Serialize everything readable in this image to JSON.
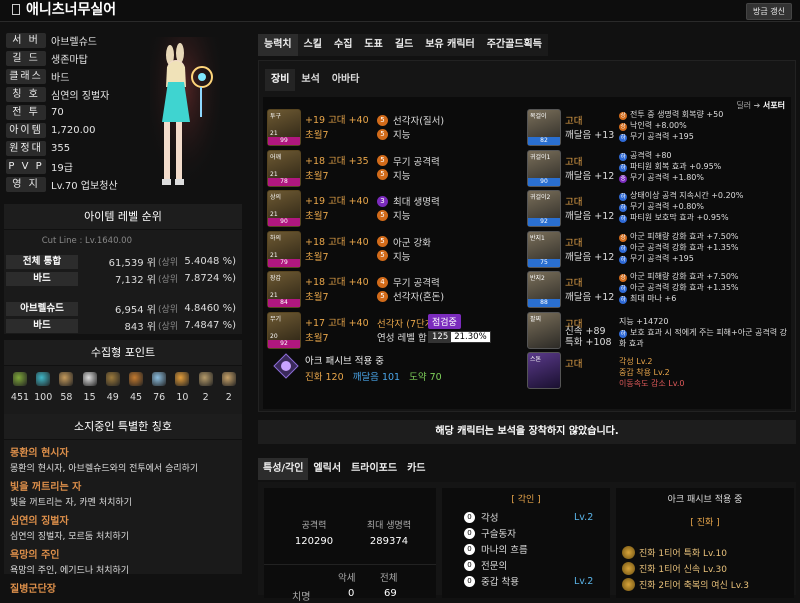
{
  "header": {
    "name": "애니츠너무실어",
    "update_label": "방금 갱신"
  },
  "profile": [
    {
      "k": "서 버",
      "v": "아브렐슈드"
    },
    {
      "k": "길 드",
      "v": "생존마탑"
    },
    {
      "k": "클래스",
      "v": "바드"
    },
    {
      "k": "칭 호",
      "v": "심연의 징벌자"
    },
    {
      "k": "전 투",
      "v": "70"
    },
    {
      "k": "아이템",
      "v": "1,720.00"
    },
    {
      "k": "원정대",
      "v": "355"
    },
    {
      "k": "P V P",
      "v": "19급"
    },
    {
      "k": "영 지",
      "v": "Lv.70 업보청산"
    }
  ],
  "rank": {
    "title": "아이템 레벨 순위",
    "cutline": "Cut Line : Lv.1640.00",
    "rows": [
      {
        "label": "전체 통합",
        "rank": "61,539 위",
        "sub": "(상위",
        "pct": "5.4048 %)"
      },
      {
        "label": "바드",
        "rank": "7,132 위",
        "sub": "(상위",
        "pct": "7.8724 %)"
      },
      {
        "label": "아브렐슈드",
        "rank": "6,954 위",
        "sub": "(상위",
        "pct": "4.8460 %)"
      },
      {
        "label": "바드",
        "rank": "843 위",
        "sub": "(상위",
        "pct": "7.4847 %)"
      }
    ]
  },
  "collect": {
    "title": "수집형 포인트",
    "items": [
      {
        "icon": "island-heart-icon",
        "n": "451",
        "color": "#7fa83a"
      },
      {
        "icon": "orpheus-star-icon",
        "n": "100",
        "color": "#3fb7c7"
      },
      {
        "icon": "giant-heart-icon",
        "n": "58",
        "color": "#c49a5c"
      },
      {
        "icon": "mokoko-seed-icon",
        "n": "15",
        "color": "#ddd"
      },
      {
        "icon": "masterpiece-icon",
        "n": "49",
        "color": "#9c7a3c"
      },
      {
        "icon": "voyage-adventure-icon",
        "n": "45",
        "color": "#c37a2f"
      },
      {
        "icon": "world-tree-leaf-icon",
        "n": "76",
        "color": "#8dbfe0"
      },
      {
        "icon": "ignea-token-icon",
        "n": "10",
        "color": "#e39d3a"
      },
      {
        "icon": "sea-bounty-icon",
        "n": "2",
        "color": "#b59b6a"
      },
      {
        "icon": "recipe-icon",
        "n": "2",
        "color": "#c8a36a"
      }
    ]
  },
  "titles": {
    "title": "소지중인 특별한 칭호",
    "items": [
      {
        "h": "몽환의 현시자",
        "d": "몽환의 현시자, 아브렐슈드와의 전투에서 승리하기"
      },
      {
        "h": "빛을 꺼트리는 자",
        "d": "빛을 꺼트리는 자, 카멘 처치하기"
      },
      {
        "h": "심연의 징벌자",
        "d": "심연의 징벌자, 모르둠 처치하기"
      },
      {
        "h": "욕망의 주인",
        "d": "욕망의 주인, 에기드나 처치하기"
      },
      {
        "h": "질병군단장",
        "d": ""
      }
    ]
  },
  "tabs": [
    "능력치",
    "스킬",
    "수집",
    "도표",
    "길드",
    "보유 캐릭터",
    "주간골드획득"
  ],
  "subtabs": [
    "장비",
    "보석",
    "아바타"
  ],
  "dealer": {
    "a": "딜러",
    "b": "서포터"
  },
  "equip": [
    {
      "slot": "투구",
      "lv": "21",
      "q": "99",
      "title": "+19 고대 +40",
      "elixir": "초월7",
      "e1": {
        "n": "5",
        "t": "선각자(질서)"
      },
      "e2": {
        "n": "5",
        "t": "지능"
      }
    },
    {
      "slot": "어깨",
      "lv": "21",
      "q": "78",
      "title": "+18 고대 +35",
      "elixir": "초월7",
      "e1": {
        "n": "5",
        "t": "무기 공격력"
      },
      "e2": {
        "n": "5",
        "t": "지능"
      }
    },
    {
      "slot": "상의",
      "lv": "21",
      "q": "90",
      "title": "+19 고대 +40",
      "elixir": "초월7",
      "e1": {
        "n": "3",
        "t": "최대 생명력",
        "p": true
      },
      "e2": {
        "n": "5",
        "t": "지능"
      }
    },
    {
      "slot": "하의",
      "lv": "21",
      "q": "79",
      "title": "+18 고대 +40",
      "elixir": "초월7",
      "e1": {
        "n": "5",
        "t": "아군 강화"
      },
      "e2": {
        "n": "5",
        "t": "지능"
      }
    },
    {
      "slot": "장갑",
      "lv": "21",
      "q": "84",
      "title": "+18 고대 +40",
      "elixir": "초월7",
      "e1": {
        "n": "4",
        "t": "무기 공격력"
      },
      "e2": {
        "n": "5",
        "t": "선각자(혼돈)"
      }
    },
    {
      "slot": "무기",
      "lv": "20",
      "q": "92",
      "title": "+17 고대 +40",
      "elixir": "초월7",
      "e1": {
        "n": "",
        "t": "선각자 (7단계)"
      },
      "e2": {
        "n": "",
        "t": "연성 레벨 합 47"
      },
      "chip": "점검중",
      "chipnum": "125",
      "chippct": "21.30%"
    }
  ],
  "acc": [
    {
      "slot": "목걸이",
      "q": "82",
      "t1": "고대",
      "t2": "깨달음 +13",
      "fx": [
        "전투 중 생명력 회복량 +50",
        "낙인력 +8.00%",
        "무기 공격력 +195"
      ],
      "fxc": [
        "or",
        "or",
        "bl"
      ]
    },
    {
      "slot": "귀걸이1",
      "q": "90",
      "t1": "고대",
      "t2": "깨달음 +12",
      "fx": [
        "공격력 +80",
        "파티원 회복 효과 +0.95%",
        "무기 공격력 +1.80%"
      ],
      "fxc": [
        "bl",
        "bl",
        "pu"
      ]
    },
    {
      "slot": "귀걸이2",
      "q": "92",
      "t1": "고대",
      "t2": "깨달음 +12",
      "fx": [
        "상태이상 공격 지속시간 +0.20%",
        "무기 공격력 +0.80%",
        "파티원 보호막 효과 +0.95%"
      ],
      "fxc": [
        "bl",
        "bl",
        "bl"
      ]
    },
    {
      "slot": "반지1",
      "q": "75",
      "t1": "고대",
      "t2": "깨달음 +12",
      "fx": [
        "아군 피해량 강화 효과 +7.50%",
        "아군 공격력 강화 효과 +1.35%",
        "무기 공격력 +195"
      ],
      "fxc": [
        "or",
        "bl",
        "bl"
      ]
    },
    {
      "slot": "반지2",
      "q": "88",
      "t1": "고대",
      "t2": "깨달음 +12",
      "fx": [
        "아군 피해량 강화 효과 +7.50%",
        "아군 공격력 강화 효과 +1.35%",
        "최대 마나 +6"
      ],
      "fxc": [
        "or",
        "bl",
        "bl"
      ]
    },
    {
      "slot": "팔찌",
      "q": "",
      "t1": "고대",
      "t2": "신속 +89 특화 +108",
      "fx": [
        "지능 +14720",
        "보호 효과 시 적에게 주는 피해+아군 공격력 강화 효과"
      ],
      "fxc": [
        "",
        "bl"
      ]
    },
    {
      "slot": "스톤",
      "q": "",
      "t1": "고대",
      "t2": "",
      "fx": [
        "각성 Lv.2",
        "중갑 착용 Lv.2",
        "이동속도 감소 Lv.0"
      ],
      "fxc": [
        "",
        "",
        ""
      ]
    }
  ],
  "arkpassive": {
    "title": "아크 패시브 적용 중",
    "jin": "진화 120",
    "kkae": "깨달음 101",
    "do": "도약 70"
  },
  "notice": "해당 캐릭터는 보석을 장착하지 않았습니다.",
  "bottomtabs": [
    "특성/각인",
    "엘릭서",
    "트라이포드",
    "카드"
  ],
  "stats": {
    "atk_label": "공격력",
    "atk": "120290",
    "hp_label": "최대 생명력",
    "hp": "289374",
    "cols": [
      "악세",
      "전체"
    ],
    "row_label": "치명",
    "v1": "0",
    "v2": "69"
  },
  "gak": {
    "title": "[ 각인 ]",
    "items": [
      {
        "c": "0",
        "t": "각성",
        "lv": "Lv.2"
      },
      {
        "c": "0",
        "t": "구슬동자",
        "lv": ""
      },
      {
        "c": "0",
        "t": "마나의 흐름",
        "lv": ""
      },
      {
        "c": "0",
        "t": "전문의",
        "lv": ""
      },
      {
        "c": "0",
        "t": "중갑 착용",
        "lv": "Lv.2"
      }
    ]
  },
  "arkbox": {
    "title": "아크 패시브 적용 중",
    "sub": "[ 진화 ]",
    "items": [
      {
        "t": "진화 1티어 특화 Lv.10"
      },
      {
        "t": "진화 1티어 신속 Lv.30"
      },
      {
        "t": "진화 2티어 축복의 여신 Lv.3"
      }
    ]
  }
}
